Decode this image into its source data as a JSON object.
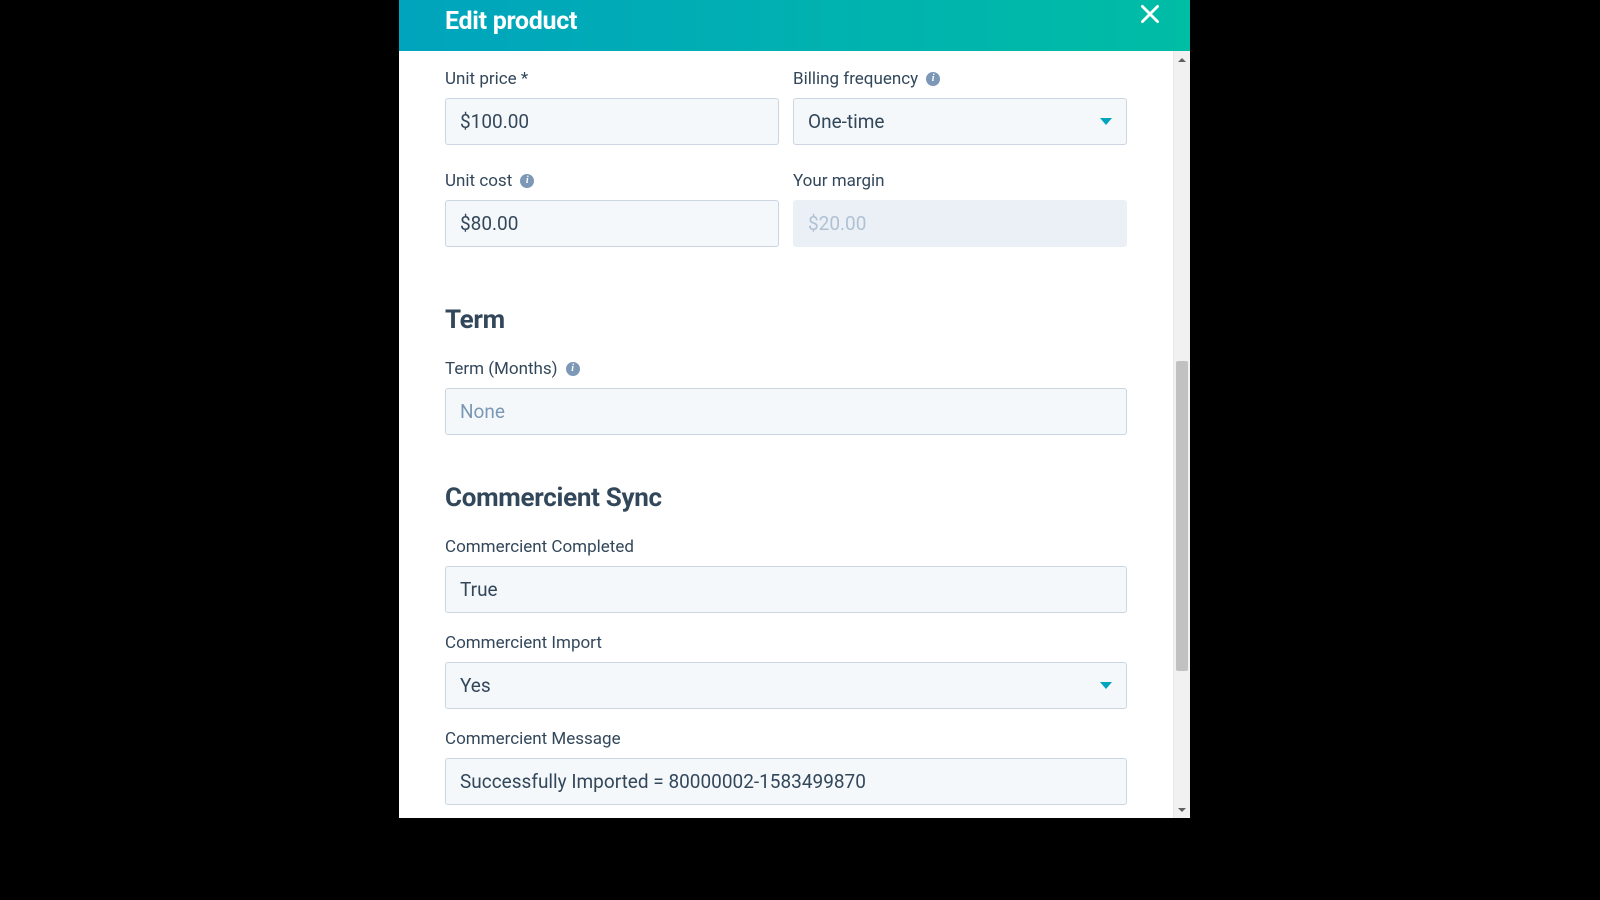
{
  "header": {
    "title": "Edit product"
  },
  "fields": {
    "unit_price": {
      "label": "Unit price *",
      "value": "$100.00"
    },
    "billing_frequency": {
      "label": "Billing frequency",
      "value": "One-time"
    },
    "unit_cost": {
      "label": "Unit cost",
      "value": "$80.00"
    },
    "your_margin": {
      "label": "Your margin",
      "value": "$20.00"
    }
  },
  "term": {
    "section_title": "Term",
    "months": {
      "label": "Term (Months)",
      "placeholder": "None"
    }
  },
  "sync": {
    "section_title": "Commercient Sync",
    "completed": {
      "label": "Commercient Completed",
      "value": "True"
    },
    "import": {
      "label": "Commercient Import",
      "value": "Yes"
    },
    "message": {
      "label": "Commercient Message",
      "value": "Successfully Imported = 80000002-1583499870"
    }
  }
}
